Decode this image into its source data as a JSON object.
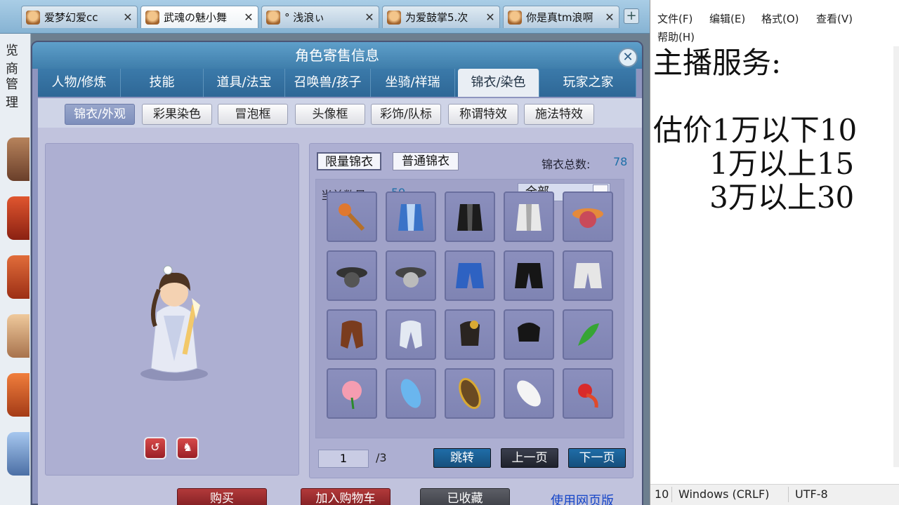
{
  "browser": {
    "tabs": [
      {
        "label": "爱梦幻爱cc",
        "active": false
      },
      {
        "label": "武魂の魅小舞",
        "active": true
      },
      {
        "label": "° 浅浪ぃ",
        "active": false
      },
      {
        "label": "为爱鼓掌5.次",
        "active": false
      },
      {
        "label": "你是真tm浪啊",
        "active": false
      }
    ],
    "close_glyph": "✕",
    "new_tab_glyph": "+"
  },
  "left_strip": {
    "text1": "览商",
    "text2": "管理"
  },
  "game": {
    "title": "角色寄售信息",
    "close_glyph": "✕",
    "main_tabs": [
      "人物/修炼",
      "技能",
      "道具/法宝",
      "召唤兽/孩子",
      "坐骑/祥瑞",
      "锦衣/染色",
      "玩家之家"
    ],
    "main_active": 5,
    "sub_tabs": [
      "锦衣/外观",
      "彩果染色",
      "冒泡框",
      "头像框",
      "彩饰/队标",
      "称谓特效",
      "施法特效"
    ],
    "sub_active": 0,
    "char_buttons": {
      "rotate_glyph": "↺",
      "action_glyph": "♞"
    },
    "kind_tabs": [
      "限量锦衣",
      "普通锦衣"
    ],
    "kind_active": 0,
    "total_label": "锦衣总数:",
    "total_value": "78",
    "current_label": "当前数量:",
    "current_value": "59",
    "filter_value": "全部",
    "filter_arrow": "⌄",
    "page_current": "1",
    "page_total": "/3",
    "jump_label": "跳转",
    "prev_label": "上一页",
    "next_label": "下一页",
    "buy_label": "购买",
    "cart_label": "加入购物车",
    "fav_label": "已收藏",
    "web_label": "使用网页版",
    "items": [
      "mace-item",
      "blue-robe-item",
      "black-robe-item",
      "white-robe-item",
      "straw-hat-item",
      "black-hat-item",
      "gray-hat-item",
      "blue-pants-item",
      "black-pants-item",
      "white-pants-item",
      "brown-hair-item",
      "silver-hair-item",
      "black-hair-crown-item",
      "black-short-hair-item",
      "green-leaf-item",
      "pink-flower-item",
      "blue-wing-item",
      "golden-wing-item",
      "white-feather-item",
      "red-dragon-item"
    ]
  },
  "notepad": {
    "menu": [
      "文件(F)",
      "编辑(E)",
      "格式(O)",
      "查看(V)",
      "帮助(H)"
    ],
    "lines": [
      "主播服务:",
      "",
      "估价1万以下10",
      "      1万以上15",
      "      3万以上30"
    ],
    "status": {
      "line": "10",
      "eol": "Windows (CRLF)",
      "encoding": "UTF-8"
    }
  }
}
